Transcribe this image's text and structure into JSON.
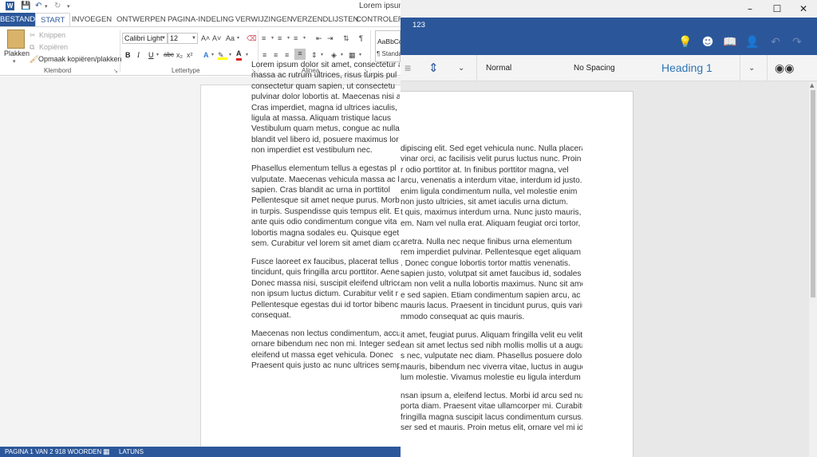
{
  "left_window": {
    "title": "Lorem ipsum",
    "tabs": [
      "BESTAND",
      "START",
      "INVOEGEN",
      "ONTWERPEN",
      "PAGINA-INDELING",
      "VERWIJZINGEN",
      "VERZENDLIJSTEN",
      "CONTROLEREN"
    ],
    "clipboard": {
      "paste_label": "Plakken",
      "cut_label": "Knippen",
      "copy_label": "Kopiëren",
      "format_painter_label": "Opmaak kopiëren/plakken",
      "group_label": "Klembord"
    },
    "font": {
      "name": "Calibri Light",
      "size": "12",
      "group_label": "Lettertype",
      "bold": "B",
      "italic": "I",
      "underline": "U",
      "strikethrough": "abc",
      "subscript": "x₂",
      "superscript": "x²",
      "grow": "A˄",
      "shrink": "A˅",
      "change_case": "Aa",
      "text_effects": "A",
      "font_color": "A"
    },
    "paragraph": {
      "group_label": "Alinea"
    },
    "styles": {
      "preview_sample": "AaBbCc",
      "preview_label": "¶ Standa"
    },
    "paragraphs": [
      [
        "Lorem ipsum dolor sit amet, consectetur a",
        "massa ac rutrum ultrices, risus turpis pul",
        "consectetur quam sapien, ut consectetu",
        "pulvinar dolor lobortis at. Maecenas nisi a",
        "Cras imperdiet, magna id ultrices iaculis,",
        "ligula at massa. Aliquam tristique lacus",
        "Vestibulum quam metus, congue ac nulla",
        "blandit vel libero id, posuere maximus lor",
        "non imperdiet est vestibulum nec."
      ],
      [
        "Phasellus elementum tellus a egestas pl",
        "vulputate. Maecenas vehicula massa ac lo",
        "sapien. Cras blandit ac urna in porttitol",
        "Pellentesque sit amet neque purus. Morb",
        "in turpis. Suspendisse quis tempus elit. Eti",
        "ante quis odio condimentum congue vita",
        "lobortis magna sodales eu. Quisque eget r",
        "sem. Curabitur vel lorem sit amet diam co"
      ],
      [
        "Fusce laoreet ex faucibus, placerat tellus s",
        "tincidunt, quis fringilla arcu porttitor. Aene",
        "Donec massa nisi, suscipit eleifend ultrice",
        "non ipsum luctus dictum. Curabitur velit r",
        "Pellentesque egestas dui id tortor bibenc",
        "consequat."
      ],
      [
        "Maecenas non lectus condimentum, accum",
        "ornare bibendum nec non mi. Integer sed f",
        "eleifend ut massa eget vehicula. Donec",
        "Praesent quis justo ac nunc ultrices semp"
      ]
    ],
    "status": {
      "page": "PAGINA 1 VAN 2",
      "words": "918 WOORDEN",
      "language": "LATUNS"
    }
  },
  "right_window": {
    "document_name": "123",
    "styles": {
      "normal": "Normal",
      "no_spacing": "No Spacing",
      "heading1": "Heading 1"
    },
    "paragraphs": [
      [
        "dipiscing elit. Sed eget vehicula nunc. Nulla placerat,",
        "vinar orci, ac facilisis velit purus luctus nunc. Proin",
        "r odio porttitor at. In finibus porttitor magna, vel",
        "arcu, venenatis a interdum vitae, interdum id justo.",
        "enim ligula condimentum nulla, vel molestie enim",
        "non justo ultricies, sit amet iaculis urna dictum.",
        "t quis, maximus interdum urna. Nunc justo mauris,",
        "em. Nam vel nulla erat. Aliquam feugiat orci tortor,"
      ],
      [
        "aretra. Nulla nec neque finibus urna elementum",
        "rem imperdiet pulvinar. Pellentesque eget aliquam",
        ". Donec congue lobortis tortor mattis venenatis.",
        "sapien justo, volutpat sit amet faucibus id, sodales",
        "am non velit a nulla lobortis maximus. Nunc sit amet",
        "e sed sapien. Etiam condimentum sapien arcu, ac",
        "mauris lacus. Praesent in tincidunt purus, quis varius",
        "mmodo consequat ac quis mauris."
      ],
      [
        "it amet, feugiat purus. Aliquam fringilla velit eu velit",
        "ean sit amet lectus sed nibh mollis mollis ut a augue.",
        "s nec, vulputate nec diam. Phasellus posuere dolor",
        "mauris, bibendum nec viverra vitae, luctus in augue.",
        "lum molestie. Vivamus molestie eu ligula interdum"
      ],
      [
        "nsan ipsum a, eleifend lectus. Morbi id arcu sed nulla",
        "porta diam. Praesent vitae ullamcorper mi. Curabitur",
        "fringilla magna suscipit lacus condimentum cursus.",
        "ser sed et mauris. Proin metus elit, ornare vel mi id,"
      ]
    ]
  }
}
